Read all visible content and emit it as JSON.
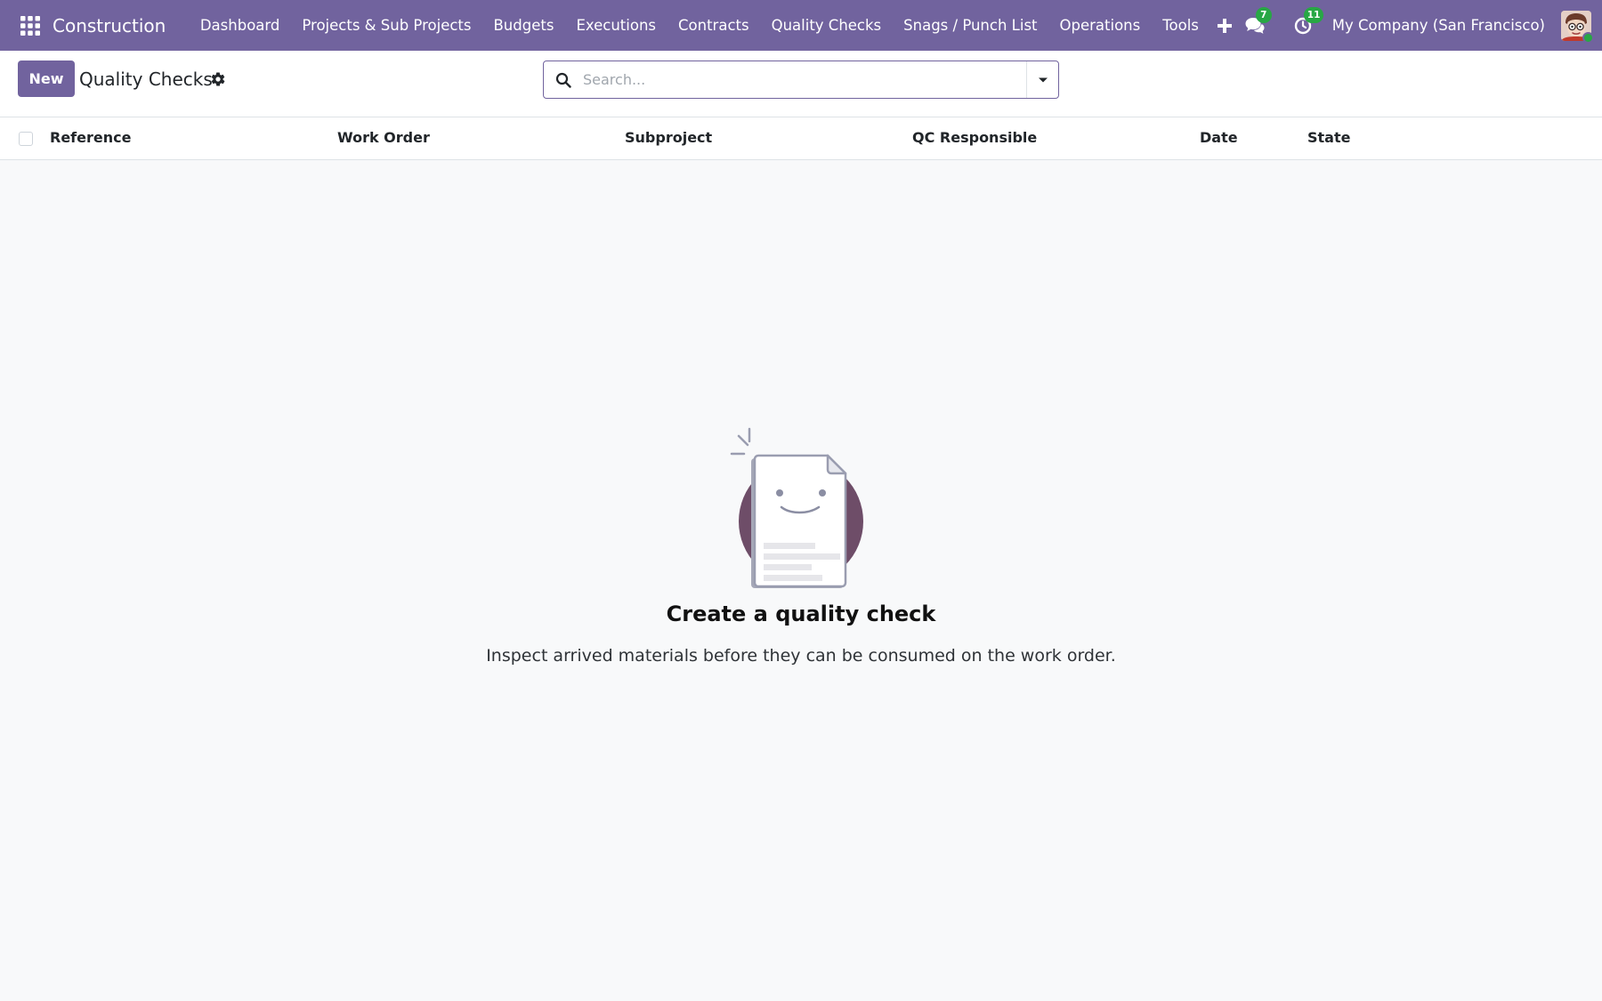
{
  "navbar": {
    "brand": "Construction",
    "menu": [
      {
        "label": "Dashboard"
      },
      {
        "label": "Projects & Sub Projects"
      },
      {
        "label": "Budgets"
      },
      {
        "label": "Executions"
      },
      {
        "label": "Contracts"
      },
      {
        "label": "Quality Checks"
      },
      {
        "label": "Snags / Punch List"
      },
      {
        "label": "Operations"
      },
      {
        "label": "Tools"
      }
    ],
    "messages_count": "7",
    "activities_count": "11",
    "company": "My Company (San Francisco)",
    "icons": {
      "apps": "apps-grid-icon",
      "add": "plus-icon",
      "messages": "chat-icon",
      "activities": "clock-icon"
    }
  },
  "control_panel": {
    "new_label": "New",
    "title": "Quality Checks",
    "search_placeholder": "Search..."
  },
  "list": {
    "columns": [
      "Reference",
      "Work Order",
      "Subproject",
      "QC Responsible",
      "Date",
      "State"
    ]
  },
  "empty_state": {
    "title": "Create a quality check",
    "text": "Inspect arrived materials before they can be consumed on the work order."
  },
  "colors": {
    "brand": "#71639e",
    "badge": "#28a745",
    "background": "#f8f9fa"
  }
}
